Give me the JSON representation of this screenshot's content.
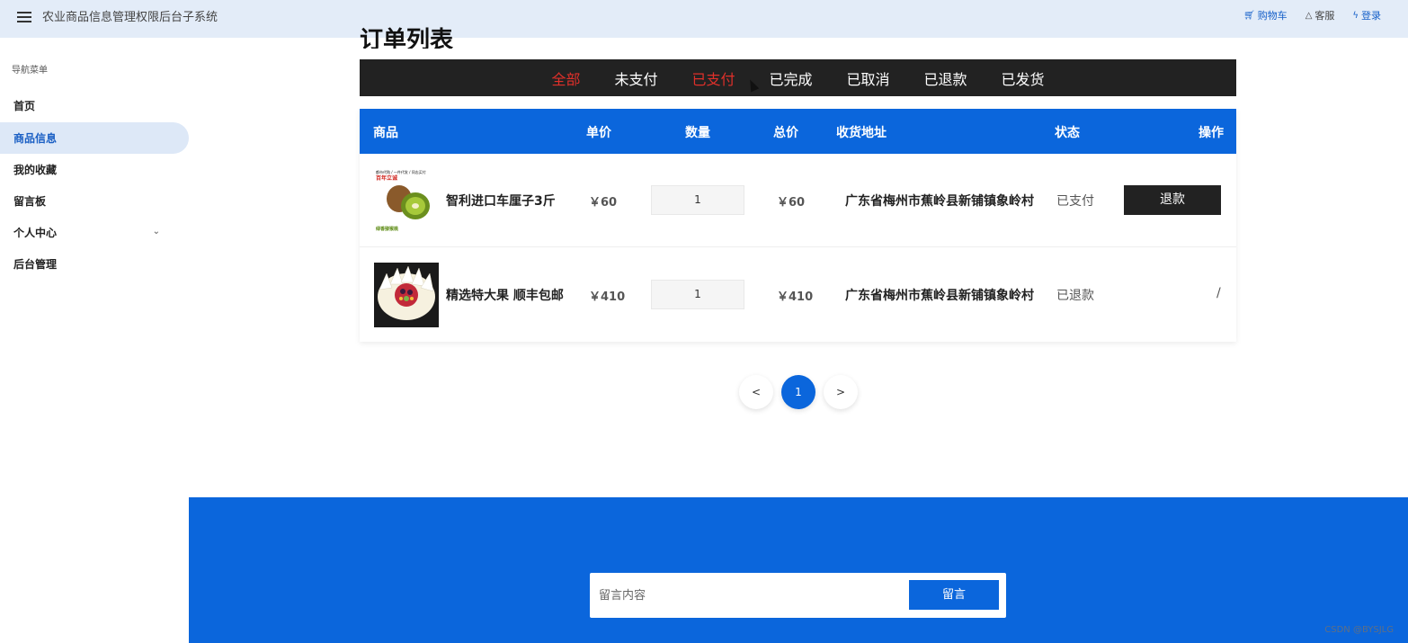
{
  "header": {
    "title": "农业商品信息管理权限后台子系统",
    "actions": {
      "cart": "购物车",
      "service": "客服",
      "login": "登录"
    }
  },
  "sidebar": {
    "heading": "导航菜单",
    "items": [
      {
        "label": "首页"
      },
      {
        "label": "商品信息",
        "active": true
      },
      {
        "label": "我的收藏"
      },
      {
        "label": "留言板"
      },
      {
        "label": "个人中心"
      },
      {
        "label": "后台管理"
      }
    ]
  },
  "main": {
    "heading": "订单列表",
    "tabs": [
      "全部",
      "未支付",
      "已支付",
      "已完成",
      "已取消",
      "已退款",
      "已发货"
    ],
    "columns": [
      "商品",
      "单价",
      "数量",
      "总价",
      "收货地址",
      "状态",
      "操作"
    ],
    "orders": [
      {
        "name": "智利进口车厘子3斤",
        "unit_price": "￥60",
        "qty": "1",
        "total": "￥60",
        "address": "广东省梅州市蕉岭县新铺镇象岭村",
        "status": "已支付",
        "action": "退款",
        "img_text_top": "都市代购 / 一件代发 / 同志买付",
        "img_text_red": "百年立诚",
        "img_text_bottom": "绿香猕猴桃"
      },
      {
        "name": "精选特大果 顺丰包邮",
        "unit_price": "￥410",
        "qty": "1",
        "total": "￥410",
        "address": "广东省梅州市蕉岭县新铺镇象岭村",
        "status": "已退款",
        "action": "/"
      }
    ],
    "pagination": {
      "prev": "<",
      "current": "1",
      "next": ">"
    }
  },
  "footer": {
    "placeholder": "留言内容",
    "button": "留言",
    "watermark": "CSDN @BYSJLG"
  },
  "colors": {
    "accent": "#0b66dc",
    "tab_bar": "#222222",
    "active_tab": "#e0302a"
  }
}
